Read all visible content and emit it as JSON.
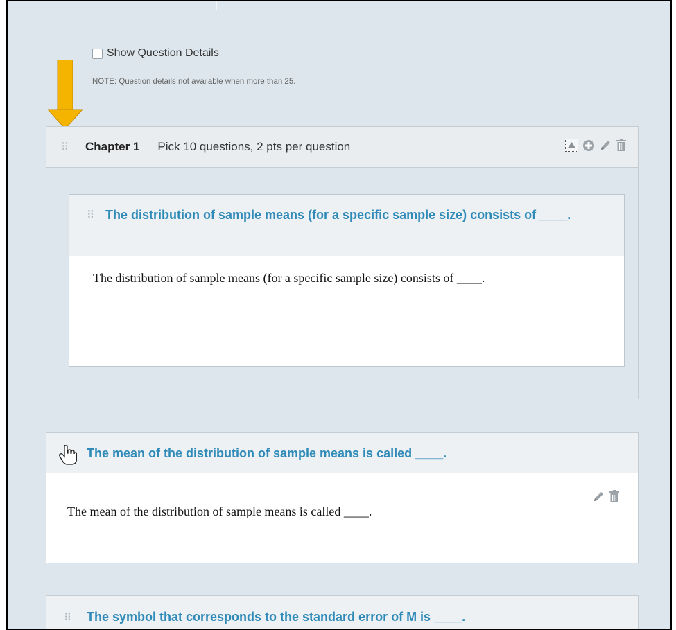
{
  "options": {
    "show_details_label": "Show Question Details",
    "show_details_checked": false,
    "note": "NOTE: Question details not available when more than 25."
  },
  "group": {
    "title": "Chapter 1",
    "description": "Pick 10 questions, 2 pts per question",
    "icons": [
      "collapse-up-icon",
      "add-icon",
      "pencil-icon",
      "trash-icon"
    ],
    "question": {
      "title": "The distribution of sample means (for a specific sample size) consists of ____.",
      "body": "The distribution of sample means (for a specific sample size) consists of ____."
    }
  },
  "questions": [
    {
      "title": "The mean of the distribution of sample means is called ____.",
      "body": "The mean of the distribution of sample means is called ____."
    },
    {
      "title": "The symbol that corresponds to the standard error of M is ____."
    }
  ],
  "colors": {
    "background": "#dde6ec",
    "link_blue": "#2f8ab8",
    "arrow": "#f4b400"
  }
}
